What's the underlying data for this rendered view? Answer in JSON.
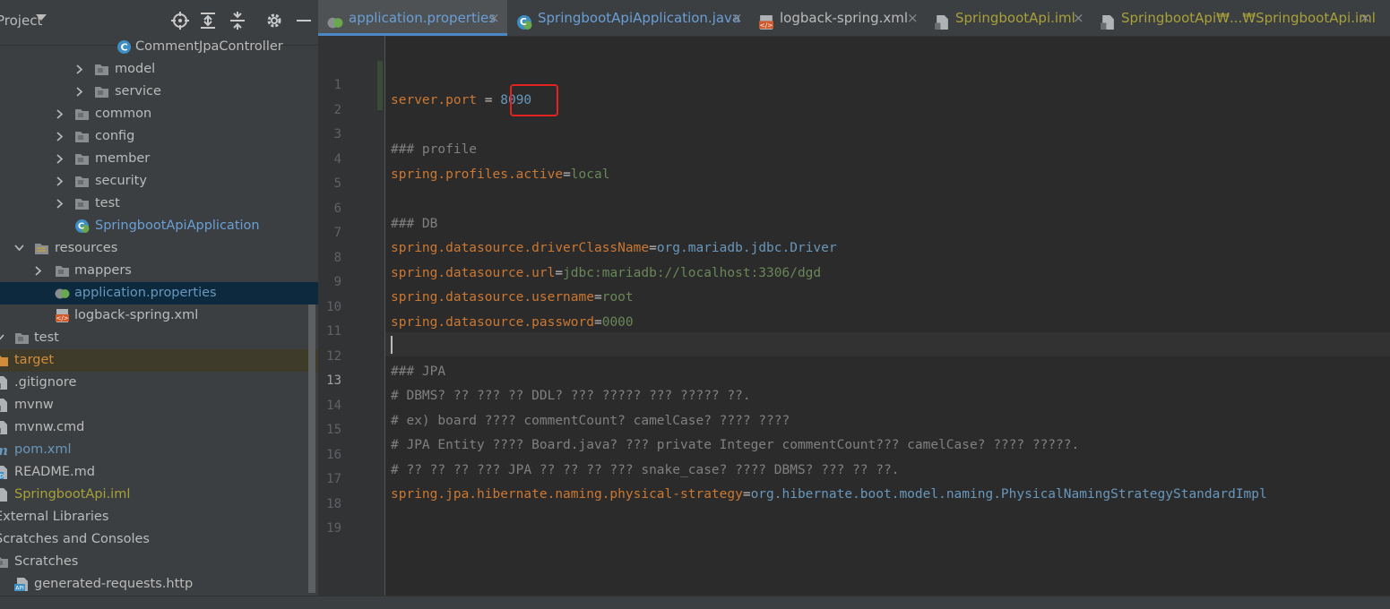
{
  "project_panel": {
    "title": "Project",
    "tree": [
      {
        "label": "CommentJpaController",
        "kind": "class"
      },
      {
        "label": "model",
        "kind": "folder"
      },
      {
        "label": "service",
        "kind": "folder"
      },
      {
        "label": "common",
        "kind": "folder"
      },
      {
        "label": "config",
        "kind": "folder"
      },
      {
        "label": "member",
        "kind": "folder"
      },
      {
        "label": "security",
        "kind": "folder"
      },
      {
        "label": "test",
        "kind": "folder"
      },
      {
        "label": "SpringbootApiApplication",
        "kind": "spring-class"
      },
      {
        "label": "resources",
        "kind": "resources-folder"
      },
      {
        "label": "mappers",
        "kind": "folder"
      },
      {
        "label": "application.properties",
        "kind": "properties"
      },
      {
        "label": "logback-spring.xml",
        "kind": "xml"
      },
      {
        "label": "test",
        "kind": "folder"
      },
      {
        "label": "target",
        "kind": "folder-excluded"
      },
      {
        "label": ".gitignore",
        "kind": "file"
      },
      {
        "label": "mvnw",
        "kind": "file"
      },
      {
        "label": "mvnw.cmd",
        "kind": "file"
      },
      {
        "label": "pom.xml",
        "kind": "maven"
      },
      {
        "label": "README.md",
        "kind": "markdown"
      },
      {
        "label": "SpringbootApi.iml",
        "kind": "iml"
      },
      {
        "label": "External Libraries",
        "kind": "libraries"
      },
      {
        "label": "Scratches and Consoles",
        "kind": "scratches"
      },
      {
        "label": "Scratches",
        "kind": "folder"
      },
      {
        "label": "generated-requests.http",
        "kind": "http"
      }
    ]
  },
  "tabs": [
    {
      "label": "application.properties",
      "icon": "spring-properties-icon",
      "active": true
    },
    {
      "label": "SpringbootApiApplication.java",
      "icon": "spring-class-icon"
    },
    {
      "label": "logback-spring.xml",
      "icon": "xml-icon"
    },
    {
      "label": "SpringbootApi.iml",
      "icon": "iml-icon"
    },
    {
      "label": "SpringbootApi₩...₩SpringbootApi.iml",
      "icon": "iml-icon"
    }
  ],
  "editor": {
    "current_line": 13,
    "lines": [
      {
        "n": "1",
        "parts": []
      },
      {
        "n": "2",
        "parts": []
      },
      {
        "n": "3",
        "parts": [
          [
            "k",
            "server.port"
          ],
          [
            "eq",
            " = "
          ],
          [
            "num",
            "8090"
          ]
        ]
      },
      {
        "n": "4",
        "parts": []
      },
      {
        "n": "5",
        "parts": [
          [
            "cmt",
            "### profile"
          ]
        ]
      },
      {
        "n": "6",
        "parts": [
          [
            "k",
            "spring.profiles.active"
          ],
          [
            "eq",
            "="
          ],
          [
            "v",
            "local"
          ]
        ]
      },
      {
        "n": "7",
        "parts": []
      },
      {
        "n": "8",
        "parts": [
          [
            "cmt",
            "### DB"
          ]
        ]
      },
      {
        "n": "9",
        "parts": [
          [
            "k",
            "spring.datasource.driverClassName"
          ],
          [
            "eq",
            "="
          ],
          [
            "cls",
            "org.mariadb.jdbc.Driver"
          ]
        ]
      },
      {
        "n": "10",
        "parts": [
          [
            "k",
            "spring.datasource.url"
          ],
          [
            "eq",
            "="
          ],
          [
            "v",
            "jdbc:mariadb://localhost:3306/dgd"
          ]
        ]
      },
      {
        "n": "11",
        "parts": [
          [
            "k",
            "spring.datasource.username"
          ],
          [
            "eq",
            "="
          ],
          [
            "v",
            "root"
          ]
        ]
      },
      {
        "n": "12",
        "parts": [
          [
            "k",
            "spring.datasource.password"
          ],
          [
            "eq",
            "="
          ],
          [
            "v",
            "0000"
          ]
        ]
      },
      {
        "n": "13",
        "parts": []
      },
      {
        "n": "14",
        "parts": [
          [
            "cmt",
            "### JPA"
          ]
        ]
      },
      {
        "n": "15",
        "parts": [
          [
            "cmt",
            "# DBMS? ?? ??? ?? DDL? ??? ????? ??? ????? ??."
          ]
        ]
      },
      {
        "n": "16",
        "parts": [
          [
            "cmt",
            "# ex) board ???? commentCount? camelCase? ???? ????"
          ]
        ]
      },
      {
        "n": "17",
        "parts": [
          [
            "cmt",
            "# JPA Entity ???? Board.java? ??? private Integer commentCount??? camelCase? ???? ?????."
          ]
        ]
      },
      {
        "n": "18",
        "parts": [
          [
            "cmt",
            "# ?? ?? ?? ??? JPA ?? ?? ?? ??? snake_case? ???? DBMS? ??? ?? ??."
          ]
        ]
      },
      {
        "n": "19",
        "parts": [
          [
            "k",
            "spring.jpa.hibernate.naming.physical-strategy"
          ],
          [
            "eq",
            "="
          ],
          [
            "cls",
            "org.hibernate.boot.model.naming.PhysicalNamingStrategyStandardImpl"
          ]
        ]
      }
    ]
  },
  "colors": {
    "keyword": "#cc7832",
    "value": "#6a8759",
    "number": "#6897bb",
    "comment": "#808080",
    "annotation_box": "#e52222"
  }
}
